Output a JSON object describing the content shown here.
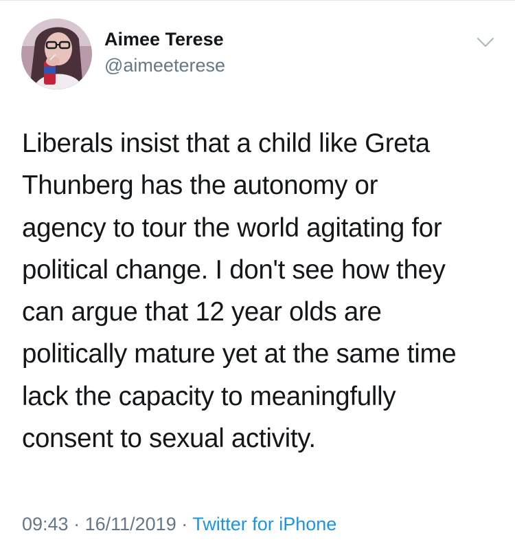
{
  "tweet": {
    "author": {
      "display_name": "Aimee Terese",
      "handle": "@aimeeterese"
    },
    "text_lines": [
      "Liberals insist that a child like Greta",
      "Thunberg has the autonomy or",
      "agency to tour the world agitating for",
      "political change. I don't see how they",
      "can argue that 12 year olds are",
      "politically mature yet at the same time",
      "lack the capacity to meaningfully",
      "consent to sexual activity."
    ],
    "meta": {
      "time": "09:43",
      "separator_1": " · ",
      "date": "16/11/2019",
      "separator_2": " · ",
      "source": "Twitter for iPhone"
    }
  },
  "icons": {
    "menu": "chevron-down-icon"
  },
  "colors": {
    "text": "#14171a",
    "secondary_text": "#657786",
    "link": "#1b95e0",
    "chevron": "#aab8c2",
    "divider": "#e1e8ed"
  }
}
